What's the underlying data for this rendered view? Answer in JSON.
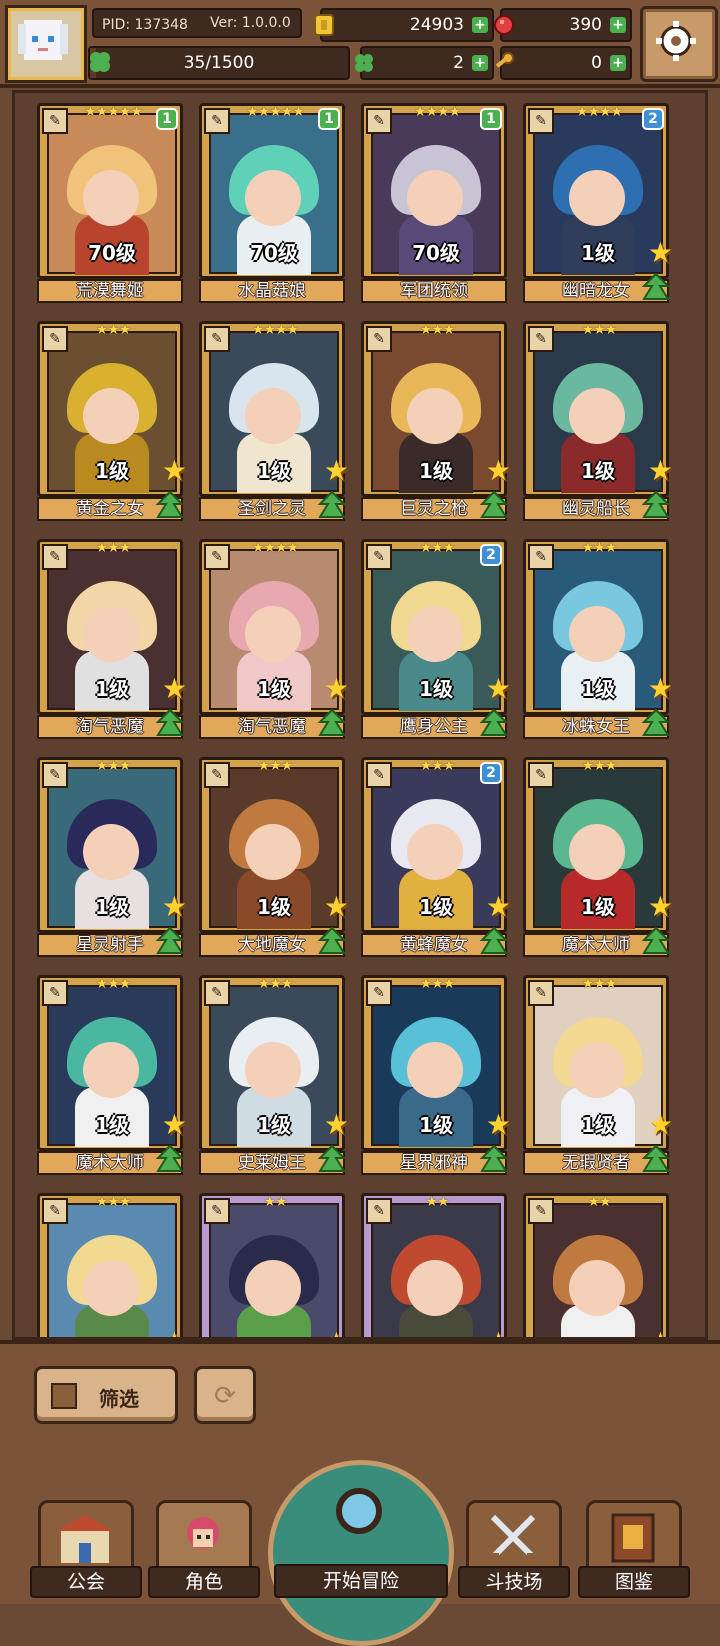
{
  "header": {
    "pid": "PID: 137348",
    "version": "Ver: 1.0.0.0",
    "exp_text": "35/1500",
    "exp_fraction": 0.023,
    "gold": "24903",
    "gems": "390",
    "clover": "2",
    "keys": "0"
  },
  "roster": [
    {
      "name": "荒漠舞姬",
      "level": "70级",
      "stars": "★★★★★",
      "rank": "1",
      "rank_color": "green",
      "frame": "gold",
      "hair": "#f1c37a",
      "body": "#b8442e",
      "bg": "#c98a5a",
      "show_star": false
    },
    {
      "name": "水晶菇娘",
      "level": "70级",
      "stars": "★★★★★",
      "rank": "1",
      "rank_color": "green",
      "frame": "gold",
      "hair": "#5fd1b8",
      "body": "#e9eef0",
      "bg": "#3a6f8c",
      "show_star": false
    },
    {
      "name": "军团统领",
      "level": "70级",
      "stars": "★★★★",
      "rank": "1",
      "rank_color": "green",
      "frame": "gold",
      "hair": "#c9c3d6",
      "body": "#5a4a7a",
      "bg": "#4a3a5a",
      "show_star": false
    },
    {
      "name": "幽暗龙女",
      "level": "1级",
      "stars": "★★★★",
      "rank": "2",
      "rank_color": "blue",
      "frame": "gold",
      "hair": "#2d6fb0",
      "body": "#2f3d5a",
      "bg": "#2a3a5c",
      "show_star": true
    },
    {
      "name": "黄金之女",
      "level": "1级",
      "stars": "★★★",
      "rank": "",
      "rank_color": "",
      "frame": "gold",
      "hair": "#d9b030",
      "body": "#b88a20",
      "bg": "#6a5030",
      "show_star": true
    },
    {
      "name": "圣剑之灵",
      "level": "1级",
      "stars": "★★★★",
      "rank": "",
      "rank_color": "",
      "frame": "gold",
      "hair": "#d8e4ee",
      "body": "#f0e6d0",
      "bg": "#3a4a5a",
      "show_star": true
    },
    {
      "name": "巨灵之枪",
      "level": "1级",
      "stars": "★★★",
      "rank": "",
      "rank_color": "",
      "frame": "gold",
      "hair": "#e8b858",
      "body": "#3a2a2a",
      "bg": "#7a4a30",
      "show_star": true
    },
    {
      "name": "幽灵船长",
      "level": "1级",
      "stars": "★★★",
      "rank": "",
      "rank_color": "",
      "frame": "gold",
      "hair": "#6ab8a0",
      "body": "#8a2a2a",
      "bg": "#2a3a4a",
      "show_star": true
    },
    {
      "name": "淘气恶魔",
      "level": "1级",
      "stars": "★★★",
      "rank": "",
      "rank_color": "",
      "frame": "gold",
      "hair": "#f2d6a8",
      "body": "#e0e0e0",
      "bg": "#4a3030",
      "show_star": true
    },
    {
      "name": "淘气恶魔",
      "level": "1级",
      "stars": "★★★★",
      "rank": "",
      "rank_color": "",
      "frame": "gold",
      "hair": "#e8a8b0",
      "body": "#f0c8c8",
      "bg": "#b88a70",
      "show_star": true
    },
    {
      "name": "鹰身公主",
      "level": "1级",
      "stars": "★★★",
      "rank": "2",
      "rank_color": "blue",
      "frame": "gold",
      "hair": "#f0d890",
      "body": "#4a8a8a",
      "bg": "#3a5a5a",
      "show_star": true
    },
    {
      "name": "冰蛛女王",
      "level": "1级",
      "stars": "★★★",
      "rank": "",
      "rank_color": "",
      "frame": "gold",
      "hair": "#7ac8e0",
      "body": "#e8f0f4",
      "bg": "#2a5a7a",
      "show_star": true
    },
    {
      "name": "星灵射手",
      "level": "1级",
      "stars": "★★★",
      "rank": "",
      "rank_color": "",
      "frame": "gold",
      "hair": "#2a2a5a",
      "body": "#e8e0e0",
      "bg": "#3a6a7a",
      "show_star": true
    },
    {
      "name": "大地魔女",
      "level": "1级",
      "stars": "★★★",
      "rank": "",
      "rank_color": "",
      "frame": "gold",
      "hair": "#c07a40",
      "body": "#8a4a2a",
      "bg": "#5a3a2a",
      "show_star": true
    },
    {
      "name": "黄蜂魔女",
      "level": "1级",
      "stars": "★★★",
      "rank": "2",
      "rank_color": "blue",
      "frame": "gold",
      "hair": "#e8e8f0",
      "body": "#e0b040",
      "bg": "#3a3a5a",
      "show_star": true
    },
    {
      "name": "魔术大师",
      "level": "1级",
      "stars": "★★★",
      "rank": "",
      "rank_color": "",
      "frame": "gold",
      "hair": "#5ab890",
      "body": "#b82a2a",
      "bg": "#2a3a3a",
      "show_star": true
    },
    {
      "name": "魔术大师",
      "level": "1级",
      "stars": "★★★",
      "rank": "",
      "rank_color": "",
      "frame": "gold",
      "hair": "#4ab8a0",
      "body": "#f0f0f0",
      "bg": "#2a3a5a",
      "show_star": true
    },
    {
      "name": "史莱姆王",
      "level": "1级",
      "stars": "★★★",
      "rank": "",
      "rank_color": "",
      "frame": "gold",
      "hair": "#e8eef2",
      "body": "#d0dce4",
      "bg": "#3a4a5a",
      "show_star": true
    },
    {
      "name": "星界邪神",
      "level": "1级",
      "stars": "★★★",
      "rank": "",
      "rank_color": "",
      "frame": "gold",
      "hair": "#5ac0d8",
      "body": "#3a6a8a",
      "bg": "#1a3a5a",
      "show_star": true
    },
    {
      "name": "无瑕贤者",
      "level": "1级",
      "stars": "★★★",
      "rank": "",
      "rank_color": "",
      "frame": "gold",
      "hair": "#f2d890",
      "body": "#f0f0f4",
      "bg": "#e0d0c0",
      "show_star": true
    },
    {
      "name": "",
      "level": "",
      "stars": "★★★",
      "rank": "",
      "rank_color": "",
      "frame": "gold",
      "hair": "#f2d890",
      "body": "#5a8a4a",
      "bg": "#5a8ab0",
      "show_star": true
    },
    {
      "name": "",
      "level": "",
      "stars": "★★",
      "rank": "",
      "rank_color": "",
      "frame": "purple",
      "hair": "#2a2a4a",
      "body": "#5aa04a",
      "bg": "#4a4a6a",
      "show_star": true
    },
    {
      "name": "",
      "level": "",
      "stars": "★★",
      "rank": "",
      "rank_color": "",
      "frame": "purple",
      "hair": "#c04a30",
      "body": "#4a4a3a",
      "bg": "#3a3a4a",
      "show_star": true
    },
    {
      "name": "",
      "level": "",
      "stars": "★★",
      "rank": "",
      "rank_color": "",
      "frame": "gold",
      "hair": "#c07a40",
      "body": "#f0f0f0",
      "bg": "#4a3030",
      "show_star": true
    }
  ],
  "controls": {
    "filter_label": "筛选"
  },
  "nav": {
    "guild": "公会",
    "character": "角色",
    "adventure": "开始冒险",
    "arena": "斗技场",
    "codex": "图鉴"
  }
}
